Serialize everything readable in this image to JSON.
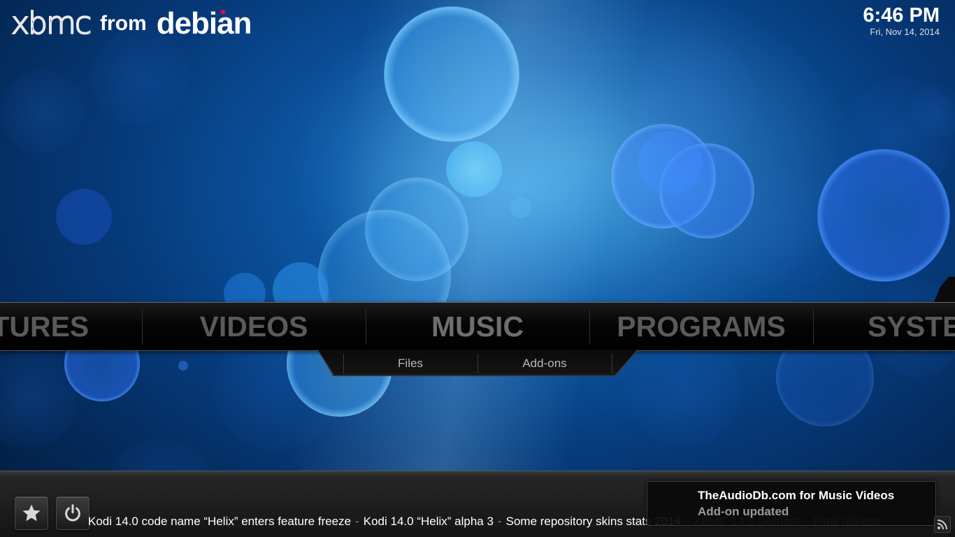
{
  "header": {
    "logo": {
      "xbmc_text": "xbmc",
      "from_text": "from",
      "brand_text": "debian"
    },
    "clock": {
      "time": "6:46 PM",
      "date": "Fri, Nov 14, 2014"
    }
  },
  "main_menu": {
    "items": [
      {
        "label": "PICTURES",
        "visible_label": "CTURES"
      },
      {
        "label": "VIDEOS"
      },
      {
        "label": "MUSIC",
        "active": true
      },
      {
        "label": "PROGRAMS"
      },
      {
        "label": "SYSTEM",
        "visible_label": "SYSTE"
      }
    ]
  },
  "submenu": {
    "items": [
      {
        "label": "Files"
      },
      {
        "label": "Add-ons"
      }
    ]
  },
  "bottom_bar": {
    "buttons": [
      {
        "icon": "star-icon",
        "label": "Favourites"
      },
      {
        "icon": "power-icon",
        "label": "Power"
      }
    ],
    "ticker": {
      "items": [
        "Kodi 14.0 code name “Helix” enters feature freeze",
        "Kodi 14.0 “Helix” alpha 3",
        "Some repository skins stats 2014",
        "XBMC 13.2 Gotham – Final release"
      ],
      "separator": "-"
    }
  },
  "notification": {
    "title": "TheAudioDb.com for Music Videos",
    "message": "Add-on updated"
  },
  "colors": {
    "accent_blue": "#4aa3ff",
    "debian_red": "#d70a53",
    "menu_text": "#5a5a5a"
  }
}
